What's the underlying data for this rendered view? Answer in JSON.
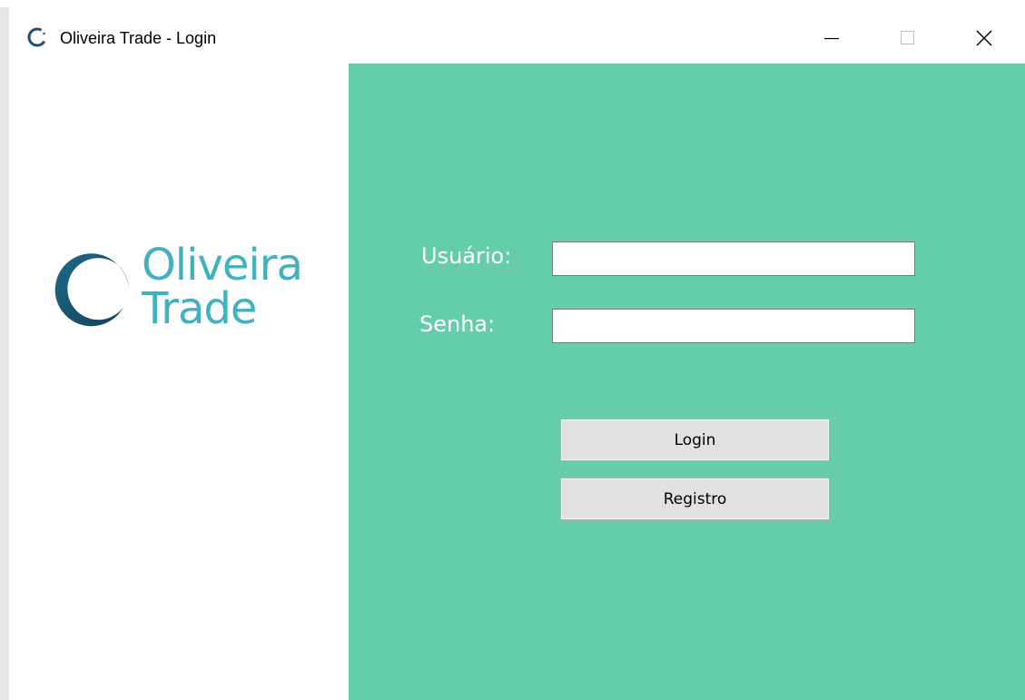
{
  "window": {
    "title": "Oliveira Trade - Login",
    "controls": {
      "minimize": "minimize",
      "maximize": "maximize",
      "close": "close"
    }
  },
  "logo": {
    "line1": "Oliveira",
    "line2": "Trade",
    "text_color": "#3fb1c0",
    "mark_color": "#1a5a7a"
  },
  "form": {
    "username_label": "Usuário:",
    "username_value": "",
    "password_label": "Senha:",
    "password_value": "",
    "login_button": "Login",
    "register_button": "Registro"
  },
  "colors": {
    "panel_background": "#66cdaa",
    "label_text": "#ffffff",
    "button_background": "#e1e1e1"
  }
}
